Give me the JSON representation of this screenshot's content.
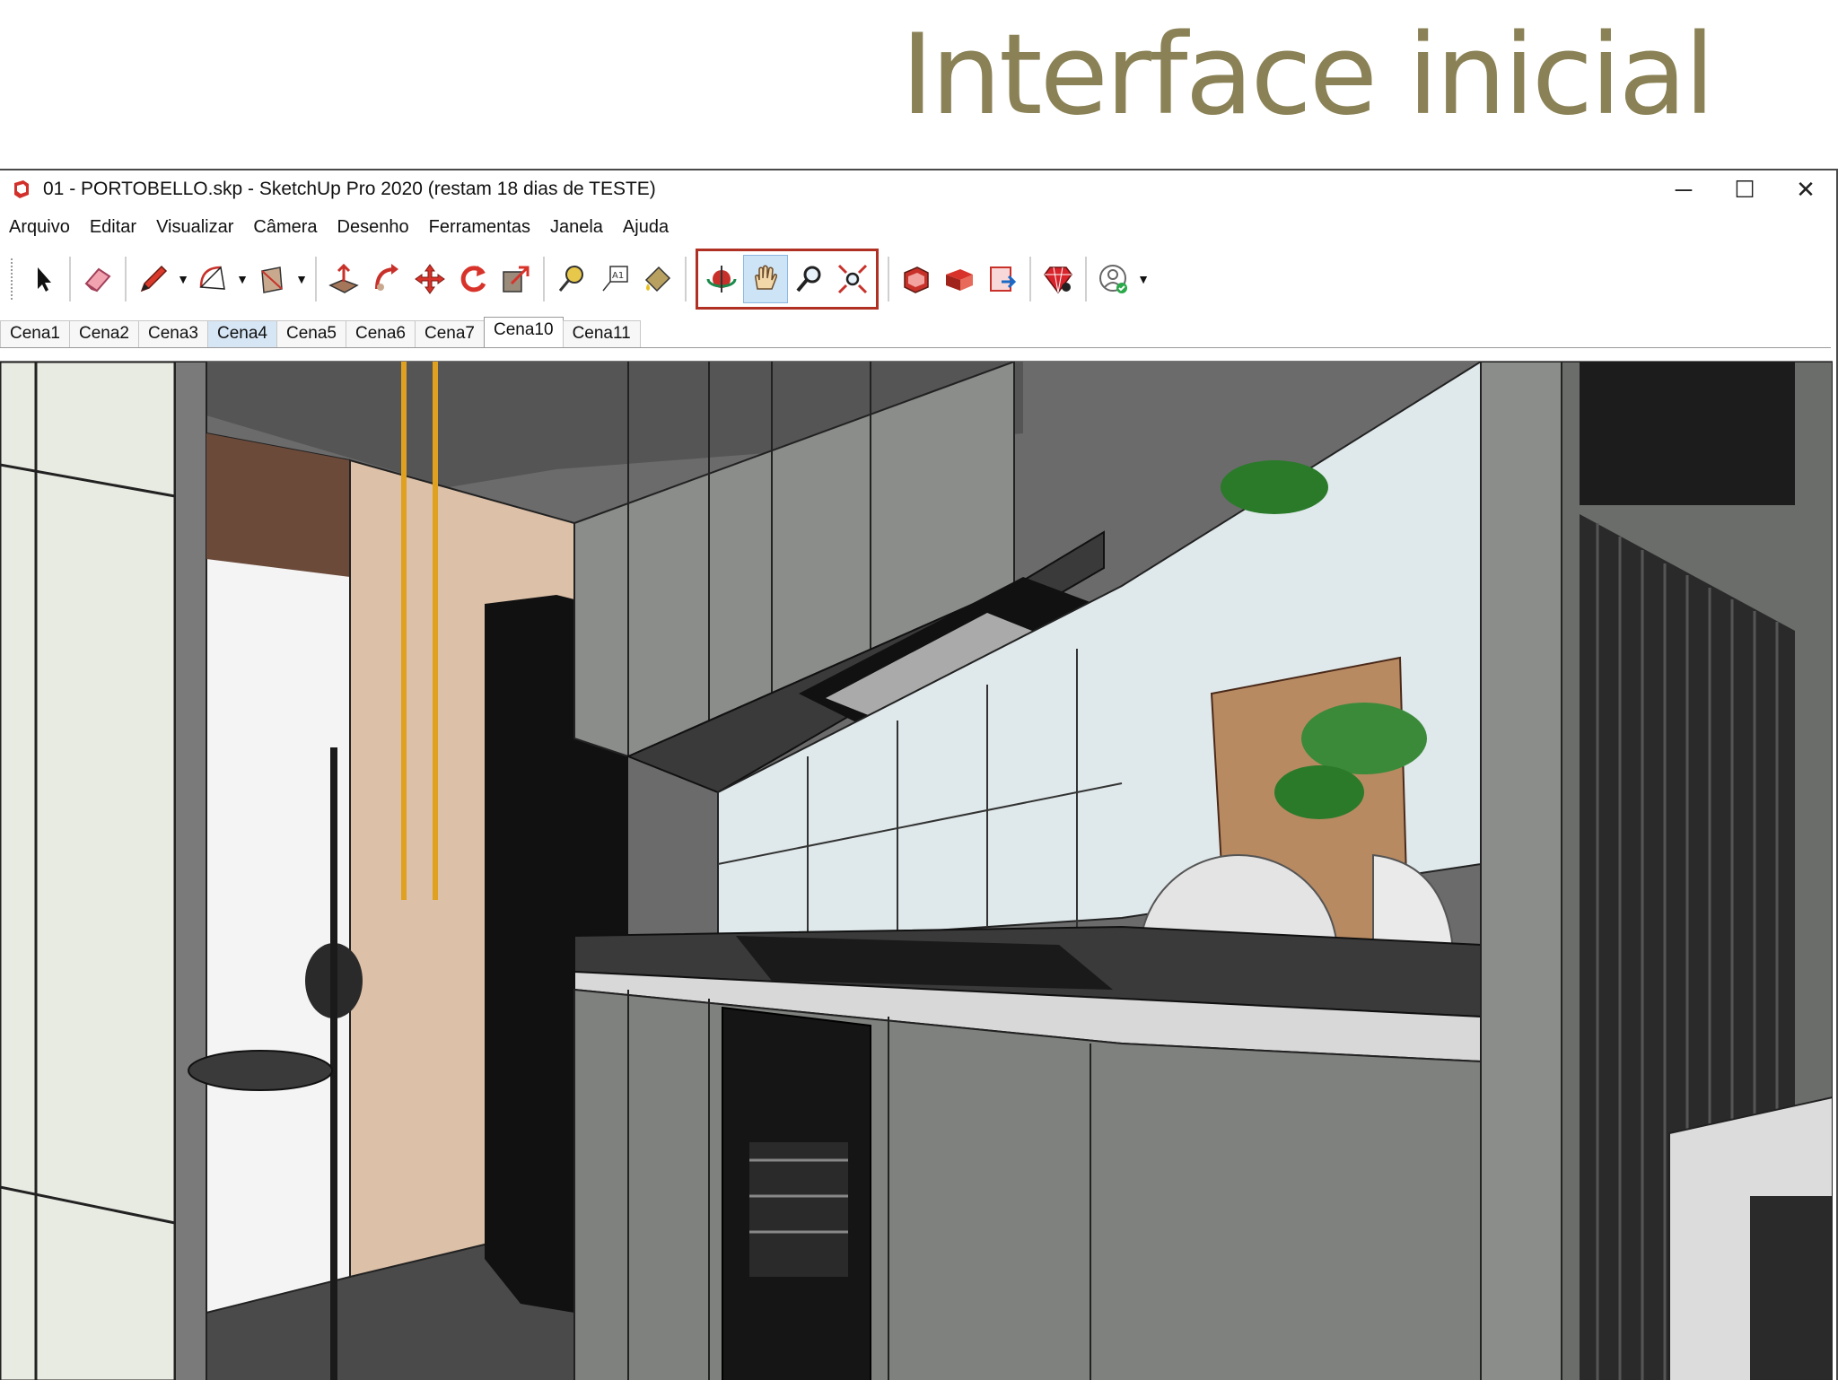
{
  "slide": {
    "title": "Interface inicial"
  },
  "window": {
    "title": "01 - PORTOBELLO.skp - SketchUp Pro 2020 (restam 18 dias de TESTE)",
    "controls": {
      "minimize": "─",
      "maximize": "☐",
      "close": "✕"
    }
  },
  "menu": [
    "Arquivo",
    "Editar",
    "Visualizar",
    "Câmera",
    "Desenho",
    "Ferramentas",
    "Janela",
    "Ajuda"
  ],
  "toolbar": {
    "icons": [
      "select-icon",
      "eraser-icon",
      "pencil-icon",
      "arc-icon",
      "rectangle-icon",
      "push-pull-icon",
      "follow-me-icon",
      "move-icon",
      "rotate-icon",
      "scale-icon",
      "tape-measure-icon",
      "text-icon",
      "paint-bucket-icon",
      "orbit-icon",
      "pan-icon",
      "zoom-icon",
      "zoom-extents-icon",
      "3d-warehouse-icon",
      "extension-warehouse-icon",
      "layout-icon",
      "extension-manager-icon",
      "profile-icon"
    ],
    "highlighted_group": [
      "orbit",
      "pan",
      "zoom",
      "zoom-extents"
    ],
    "active_tool": "pan",
    "highlight_color": "#b03024"
  },
  "scenes": [
    "Cena1",
    "Cena2",
    "Cena3",
    "Cena4",
    "Cena5",
    "Cena6",
    "Cena7",
    "Cena10",
    "Cena11"
  ],
  "selected_scene": "Cena4",
  "current_scene": "Cena10"
}
